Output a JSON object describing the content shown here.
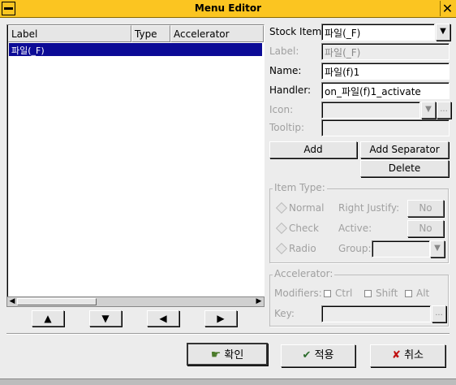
{
  "window": {
    "title": "Menu Editor"
  },
  "list": {
    "columns": [
      "Label",
      "Type",
      "Accelerator"
    ],
    "rows": [
      {
        "label": "파일(_F)",
        "type": "",
        "accelerator": ""
      }
    ]
  },
  "arrows": {
    "up": "▲",
    "down": "▼",
    "left": "◀",
    "right": "▶"
  },
  "form": {
    "stock_item_label": "Stock Item:",
    "stock_item_value": "파일(_F)",
    "label_label": "Label:",
    "label_value": "파일(_F)",
    "name_label": "Name:",
    "name_value": "파일(f)1",
    "handler_label": "Handler:",
    "handler_value": "on_파일(f)1_activate",
    "icon_label": "Icon:",
    "icon_browse": "...",
    "tooltip_label": "Tooltip:",
    "add_button": "Add",
    "add_separator_button": "Add Separator",
    "delete_button": "Delete"
  },
  "item_type": {
    "title": "Item Type:",
    "normal": "Normal",
    "check": "Check",
    "radio": "Radio",
    "right_justify_label": "Right Justify:",
    "right_justify_value": "No",
    "active_label": "Active:",
    "active_value": "No",
    "group_label": "Group:"
  },
  "accelerator": {
    "title": "Accelerator:",
    "modifiers_label": "Modifiers:",
    "ctrl": "Ctrl",
    "shift": "Shift",
    "alt": "Alt",
    "key_label": "Key:",
    "key_browse": "..."
  },
  "footer": {
    "ok_label": "확인",
    "apply_label": "적용",
    "cancel_label": "취소"
  },
  "colors": {
    "title_bar": "#fbc521",
    "selection": "#0c0b96"
  }
}
